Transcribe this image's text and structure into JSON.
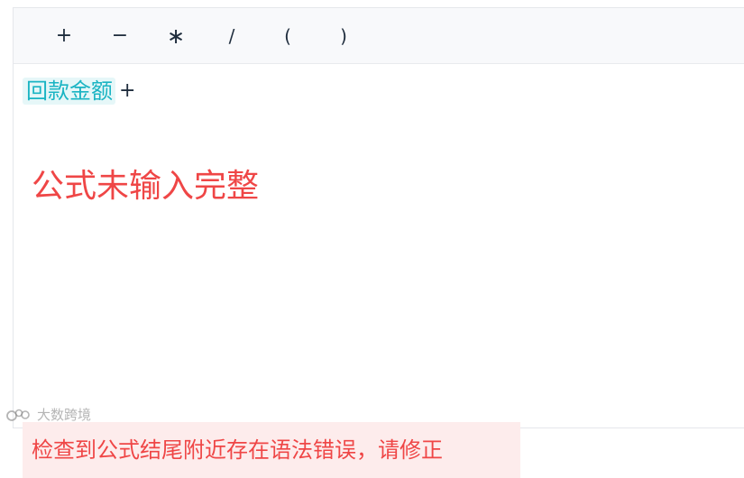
{
  "toolbar": {
    "operators": {
      "plus": "+",
      "minus": "−",
      "multiply": "∗",
      "divide": "/",
      "lparen": "(",
      "rparen": ")"
    }
  },
  "formula": {
    "field": "回款金额",
    "operator": "+"
  },
  "messages": {
    "incomplete": "公式未输入完整",
    "syntax_error": "检查到公式结尾附近存在语法错误，请修正"
  },
  "watermark": {
    "text": "大数跨境"
  },
  "colors": {
    "field_text": "#1ab4c3",
    "field_bg": "#e6f7f8",
    "error_text": "#ef4646",
    "error_bg": "#fdecec"
  }
}
